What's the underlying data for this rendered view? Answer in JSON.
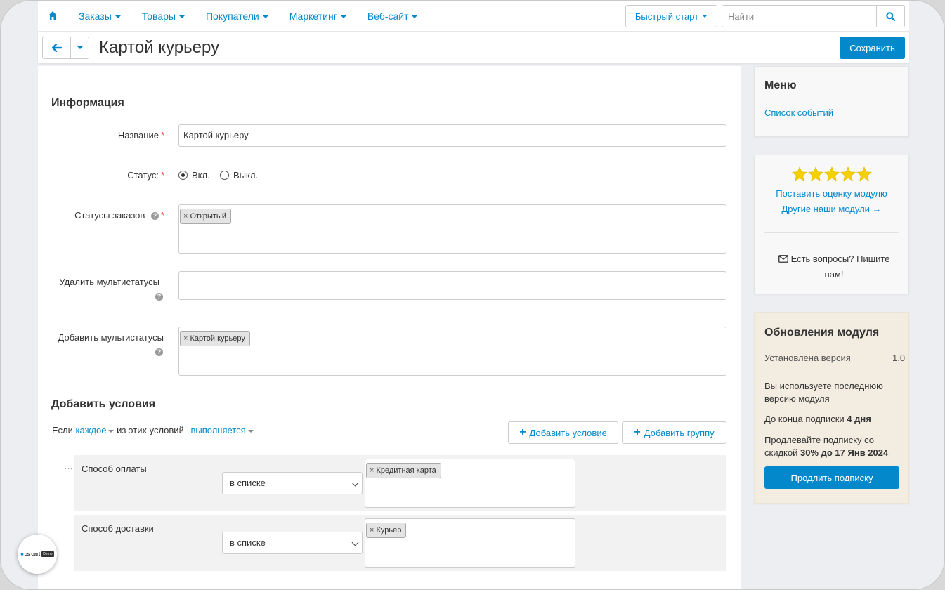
{
  "nav": {
    "items": [
      "Заказы",
      "Товары",
      "Покупатели",
      "Маркетинг",
      "Веб-сайт"
    ],
    "quick_start": "Быстрый старт",
    "search_placeholder": "Найти"
  },
  "header": {
    "title": "Картой курьеру",
    "save_label": "Сохранить"
  },
  "form": {
    "section_info": "Информация",
    "name_label": "Название",
    "name_value": "Картой курьеру",
    "status_label": "Статус:",
    "status_on": "Вкл.",
    "status_off": "Выкл.",
    "order_statuses_label": "Статусы заказов",
    "order_statuses_tags": [
      "Открытый"
    ],
    "remove_multi_label": "Удалить мультистатусы",
    "add_multi_label": "Добавить мультистатусы",
    "add_multi_tags": [
      "Картой курьеру"
    ]
  },
  "conditions": {
    "title": "Добавить условия",
    "if_text": "Если",
    "each_text": "каждое",
    "of_these": "из этих условий",
    "fulfilled": "выполняется",
    "add_condition": "Добавить условие",
    "add_group": "Добавить группу",
    "rows": [
      {
        "name": "Способ оплаты",
        "operator": "в списке",
        "tag": "Кредитная карта"
      },
      {
        "name": "Способ доставки",
        "operator": "в списке",
        "tag": "Курьер"
      }
    ]
  },
  "sidebar": {
    "menu_title": "Меню",
    "menu_link": "Список событий",
    "rating": 5,
    "rate_link": "Поставить оценку модулю",
    "other_link": "Другие наши модули →",
    "questions": "Есть вопросы? Пишите нам!",
    "updates_title": "Обновления модуля",
    "installed_label": "Установлена версия",
    "installed_value": "1.0",
    "latest_text": "Вы используете последнюю версию модуля",
    "sub_end_prefix": "До конца подписки",
    "sub_end_value": "4 дня",
    "renew_prefix": "Продлевайте подписку со скидкой",
    "renew_bold": "30% до 17 Янв 2024",
    "renew_button": "Продлить подписку"
  },
  "logo": {
    "text": "cs cart",
    "badge": "Demo"
  },
  "colors": {
    "accent": "#0388cc",
    "required": "#e64d3d",
    "star": "#f5d000"
  }
}
